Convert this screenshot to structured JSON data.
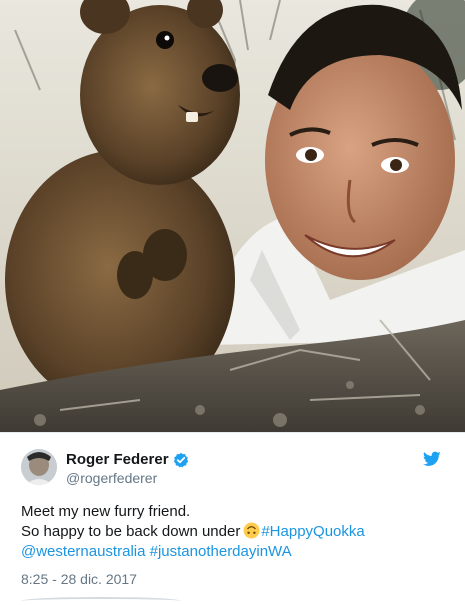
{
  "tweet": {
    "display_name": "Roger Federer",
    "handle": "@rogerfederer",
    "verified": true,
    "line1": "Meet my new furry friend.",
    "line2_text": "So happy to be back down under",
    "line2_emoji": "upside-down-face-emoji",
    "line2_hashtag": "#HappyQuokka",
    "line3_mention": "@westernaustralia",
    "line3_hashtag": "#justanotherdayinWA",
    "timestamp": "8:25 - 28 dic. 2017"
  },
  "icons": {
    "verified": "verified-badge-icon",
    "brand": "twitter-bird-icon"
  },
  "colors": {
    "link": "#1b95e0",
    "verified": "#1da1f2",
    "secondary_text": "#657786"
  }
}
